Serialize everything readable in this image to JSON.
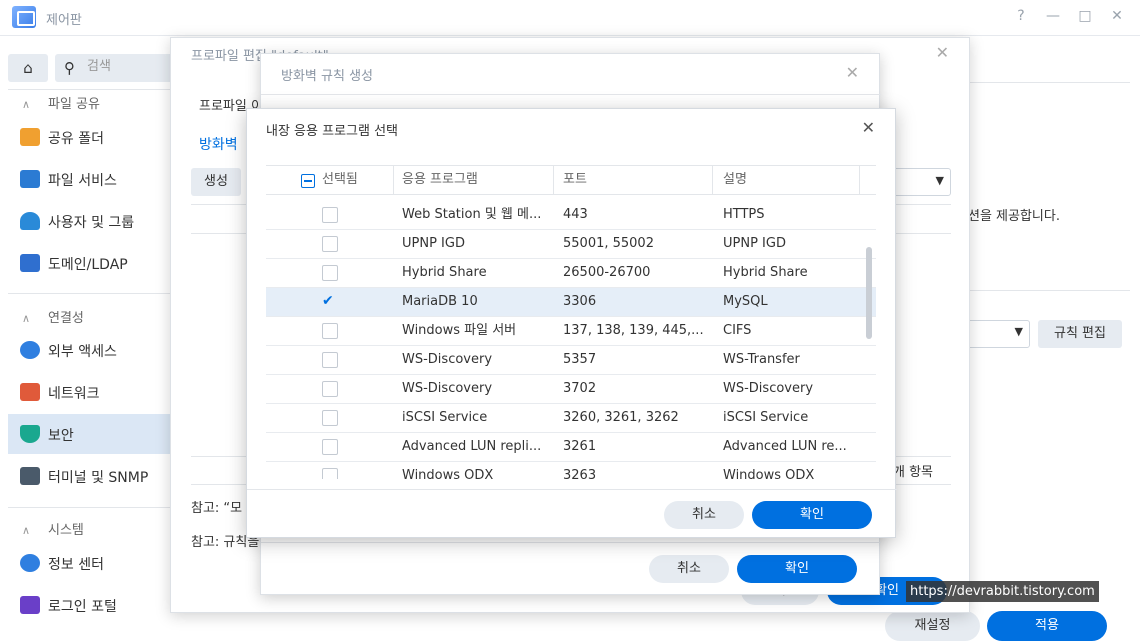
{
  "window": {
    "title": "제어판",
    "help": "?",
    "minimize": "—",
    "maximize": "□",
    "close": "✕"
  },
  "sidebar": {
    "home_icon": "⌂",
    "search_placeholder": "검색",
    "search_icon": "⚲",
    "sections": [
      {
        "label": "파일 공유",
        "items": [
          "공유 폴더",
          "파일 서비스",
          "사용자 및 그룹",
          "도메인/LDAP"
        ]
      },
      {
        "label": "연결성",
        "items": [
          "외부 액세스",
          "네트워크",
          "보안",
          "터미널 및 SNMP"
        ]
      },
      {
        "label": "시스템",
        "items": [
          "정보 센터",
          "로그인 포털"
        ]
      }
    ],
    "active_item": "보안",
    "chevron": "∧",
    "icon_colors": [
      "#f0a030",
      "#2b7bd3",
      "#2a8ad8",
      "#2f6fcf",
      "#2f7fe0",
      "#e05a3a",
      "#1aa88f",
      "#4a5a6a",
      "#2f7fe0",
      "#6a3fc8"
    ]
  },
  "background": {
    "right_text": "션을 제공합니다.",
    "rule_edit": "규칙 편집",
    "reset": "재설정",
    "apply": "적용"
  },
  "dialog_profile": {
    "title": "프로파일 편집 \"default\"",
    "profile_label": "프로파일 이",
    "tab": "방화벽",
    "create_button": "생성",
    "note1": "참고: “모",
    "note2": "참고: 규칙을",
    "count_text": "개 항목",
    "cancel": "취",
    "ok": "확인"
  },
  "dialog_rule": {
    "title": "방화벽 규칙 생성",
    "cancel": "취소",
    "ok": "확인"
  },
  "dialog_app": {
    "title": "내장 응용 프로그램 선택",
    "close": "✕",
    "columns": {
      "selected": "선택됨",
      "app": "응용 프로그램",
      "port": "포트",
      "desc": "설명"
    },
    "rows": [
      {
        "checked": false,
        "app": "Web Station 및 웹 메...",
        "port": "443",
        "desc": "HTTPS"
      },
      {
        "checked": false,
        "app": "UPNP IGD",
        "port": "55001, 55002",
        "desc": "UPNP IGD"
      },
      {
        "checked": false,
        "app": "Hybrid Share",
        "port": "26500-26700",
        "desc": "Hybrid Share"
      },
      {
        "checked": true,
        "app": "MariaDB 10",
        "port": "3306",
        "desc": "MySQL"
      },
      {
        "checked": false,
        "app": "Windows 파일 서버",
        "port": "137, 138, 139, 445,...",
        "desc": "CIFS"
      },
      {
        "checked": false,
        "app": "WS-Discovery",
        "port": "5357",
        "desc": "WS-Transfer"
      },
      {
        "checked": false,
        "app": "WS-Discovery",
        "port": "3702",
        "desc": "WS-Discovery"
      },
      {
        "checked": false,
        "app": "iSCSI Service",
        "port": "3260, 3261, 3262",
        "desc": "iSCSI Service"
      },
      {
        "checked": false,
        "app": "Advanced LUN repli...",
        "port": "3261",
        "desc": "Advanced LUN re..."
      },
      {
        "checked": false,
        "app": "Windows ODX",
        "port": "3263",
        "desc": "Windows ODX"
      }
    ],
    "check_glyph": "✔",
    "cancel": "취소",
    "ok": "확인"
  },
  "watermark": "https://devrabbit.tistory.com",
  "colors": {
    "accent": "#0070e0",
    "selected_row": "#e5eef8",
    "active_nav": "#dbe7f5"
  }
}
